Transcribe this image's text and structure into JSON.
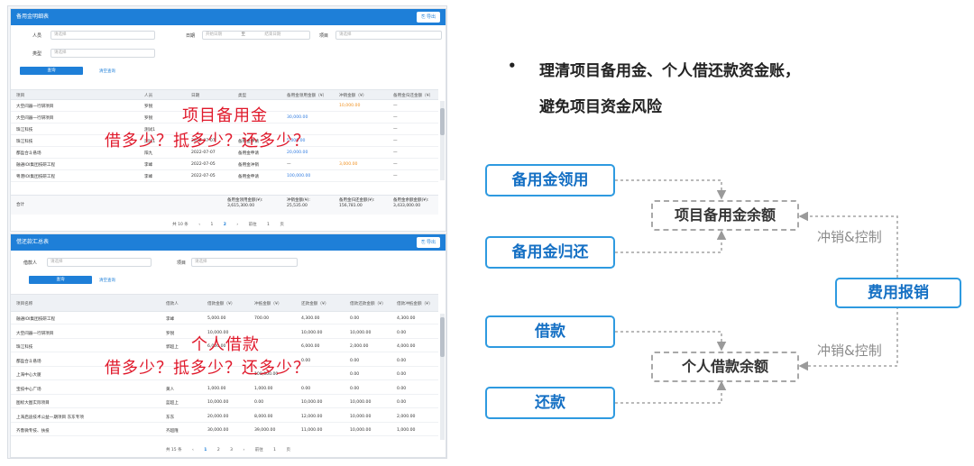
{
  "panel1": {
    "title": "备用金明细表",
    "export_label": "导出",
    "filters": {
      "person_label": "人员",
      "person_placeholder": "请选择",
      "date_label": "日期",
      "date_start_placeholder": "开始日期",
      "date_sep": "至",
      "date_end_placeholder": "结束日期",
      "project_label": "项目",
      "project_placeholder": "请选择",
      "type_label": "类型",
      "type_placeholder": "请选择",
      "query_label": "查询",
      "reset_label": "清空查询"
    },
    "columns": [
      "项目",
      "人员",
      "日期",
      "类型",
      "备用金领用金额（¥）",
      "冲销金额（¥）",
      "备用金归还金额（¥）"
    ],
    "rows": [
      [
        "大空间器一行研项目",
        "罗锐",
        "",
        "",
        "",
        "10,000.00",
        "—"
      ],
      [
        "大空间器一行研项目",
        "罗锐",
        "",
        "",
        "30,000.00",
        "",
        "—"
      ],
      [
        "珠江科技",
        "测试1",
        "",
        "",
        "",
        "",
        "—"
      ],
      [
        "珠江科技",
        "测试1",
        "2022-07-07",
        "备用金申请",
        "5,000.00",
        "",
        "—"
      ],
      [
        "都盈合斗悬场",
        "阳九",
        "2022-07-07",
        "备用金申请",
        "20,000.00",
        "",
        "—"
      ],
      [
        "融通IOI集团技研工程",
        "李峰",
        "2022-07-05",
        "备用金冲销",
        "—",
        "3,000.00",
        "—"
      ],
      [
        "粤港IOI集团技研工程",
        "李峰",
        "2022-07-05",
        "备用金申请",
        "100,000.00",
        "",
        "—"
      ]
    ],
    "total_label": "合计",
    "summary": [
      {
        "label": "备用金领用金额(¥):",
        "value": "3,615,300.00"
      },
      {
        "label": "冲销金额(¥):",
        "value": "25,535.00"
      },
      {
        "label": "备用金归还金额(¥):",
        "value": "156,781.00"
      },
      {
        "label": "备用金余额金额(¥):",
        "value": "3,433,000.00"
      }
    ],
    "pager": {
      "total": "共 10 条",
      "prev": "‹",
      "pages": [
        "1",
        "2"
      ],
      "active": "2",
      "next": "›",
      "goto": "前往",
      "page_input": "1",
      "unit": "页"
    },
    "overlay": {
      "line1": "项目备用金",
      "line2": "借多少？抵多少？还多少？"
    }
  },
  "panel2": {
    "title": "借还款汇总表",
    "export_label": "导出",
    "filters": {
      "person_label": "借款人",
      "person_placeholder": "请选择",
      "project_label": "项目",
      "project_placeholder": "请选择",
      "query_label": "查询",
      "reset_label": "清空查询"
    },
    "columns": [
      "项目名称",
      "借款人",
      "借款金额（¥）",
      "冲抵金额（¥）",
      "还款金额（¥）",
      "借款还款金额（¥）",
      "借款冲抵金额（¥）"
    ],
    "rows": [
      [
        "融通IOI集团技研工程",
        "李峰",
        "5,000.00",
        "700.00",
        "4,300.00",
        "0.00",
        "4,300.00"
      ],
      [
        "大空间器一行研项目",
        "罗锐",
        "10,000.00",
        "",
        "10,000.00",
        "10,000.00",
        "0.00"
      ],
      [
        "珠江科技",
        "郭超上",
        "6,000.00",
        "",
        "6,000.00",
        "2,000.00",
        "4,000.00"
      ],
      [
        "都盈合斗悬场",
        "",
        "",
        "",
        "0.00",
        "0.00",
        "0.00"
      ],
      [
        "上海中心大厦",
        "",
        "",
        "100,000.00",
        "",
        "0.00",
        "0.00"
      ],
      [
        "宝技中心广场",
        "黄人",
        "1,000.00",
        "1,000.00",
        "0.00",
        "0.00",
        "0.00"
      ],
      [
        "图标大图实际项目",
        "蓝超上",
        "10,000.00",
        "0.00",
        "10,000.00",
        "10,000.00",
        "0.00"
      ],
      [
        "上海启迪技术公益一期项目 东东专项",
        "东东",
        "20,000.00",
        "8,000.00",
        "12,000.00",
        "10,000.00",
        "2,000.00"
      ],
      [
        "齐鲁微专技、扶投",
        "齐超隆",
        "30,000.00",
        "39,000.00",
        "11,000.00",
        "10,000.00",
        "1,000.00"
      ]
    ],
    "pager": {
      "total": "共 15 条",
      "prev": "‹",
      "pages": [
        "1",
        "2",
        "3"
      ],
      "active": "1",
      "next": "›",
      "goto": "前往",
      "page_input": "1",
      "unit": "页"
    },
    "overlay": {
      "line1": "个人借款",
      "line2": "借多少？抵多少？还多少？"
    }
  },
  "right": {
    "bullet": "•",
    "line1": "理清项目备用金、个人借还款资金账，",
    "line2": "避免项目资金风险",
    "box_imprest_use": "备用金领用",
    "box_imprest_return": "备用金归还",
    "box_loan": "借款",
    "box_repay": "还款",
    "box_project_balance": "项目备用金余额",
    "box_personal_balance": "个人借款余额",
    "box_reimburse": "费用报销",
    "control_top": "冲销&控制",
    "control_bottom": "冲销&控制"
  },
  "colors": {
    "accent": "#1e7fd8",
    "box_border": "#2e9ae0",
    "overlay_red": "#e0192b"
  }
}
